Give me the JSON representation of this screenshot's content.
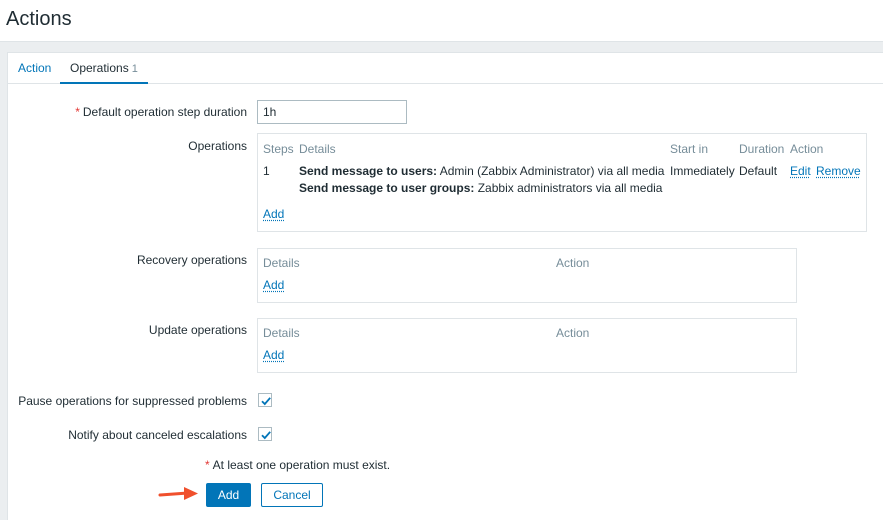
{
  "page": {
    "title": "Actions"
  },
  "tabs": [
    {
      "label": "Action"
    },
    {
      "label": "Operations",
      "count": "1"
    }
  ],
  "form": {
    "step_duration": {
      "label": "Default operation step duration",
      "value": "1h",
      "required": true
    },
    "operations": {
      "label": "Operations",
      "headers": [
        "Steps",
        "Details",
        "Start in",
        "Duration",
        "Action"
      ],
      "rows": [
        {
          "steps": "1",
          "line1_bold": "Send message to users:",
          "line1_rest": " Admin (Zabbix Administrator) via all media",
          "line2_bold": "Send message to user groups:",
          "line2_rest": " Zabbix administrators via all media",
          "start_in": "Immediately",
          "duration": "Default",
          "edit": "Edit",
          "remove": "Remove"
        }
      ],
      "add": "Add"
    },
    "recovery_operations": {
      "label": "Recovery operations",
      "headers": [
        "Details",
        "Action"
      ],
      "add": "Add"
    },
    "update_operations": {
      "label": "Update operations",
      "headers": [
        "Details",
        "Action"
      ],
      "add": "Add"
    },
    "pause_suppressed": {
      "label": "Pause operations for suppressed problems",
      "checked": true
    },
    "notify_canceled": {
      "label": "Notify about canceled escalations",
      "checked": true
    },
    "validation_message": "At least one operation must exist.",
    "buttons": {
      "add": "Add",
      "cancel": "Cancel"
    }
  },
  "colors": {
    "accent": "#0275b8",
    "required": "#e33734",
    "arrow": "#f0502d"
  }
}
